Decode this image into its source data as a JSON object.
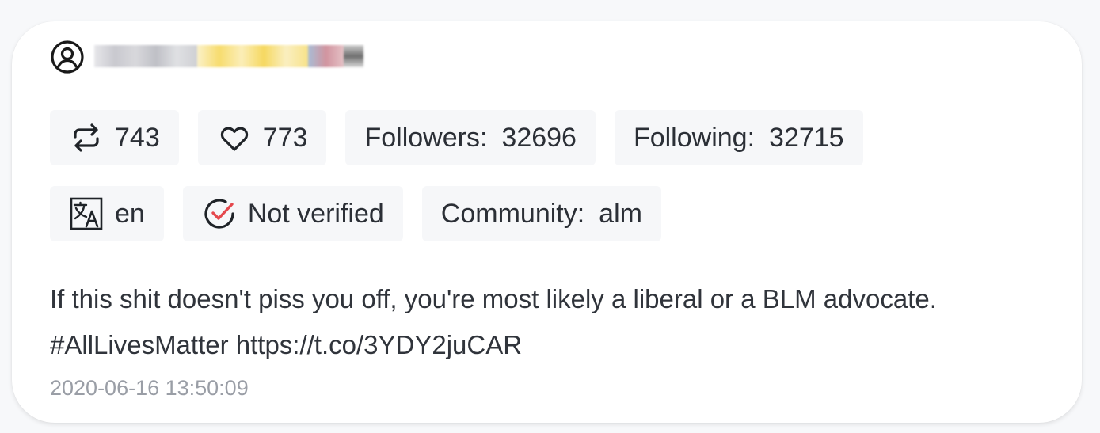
{
  "header": {
    "user_icon": "user-circle-icon",
    "username_redacted": true
  },
  "stats": {
    "retweets": {
      "icon": "retweet-icon",
      "value": "743"
    },
    "likes": {
      "icon": "heart-icon",
      "value": "773"
    },
    "followers": {
      "label": "Followers:",
      "value": "32696"
    },
    "following": {
      "label": "Following:",
      "value": "32715"
    }
  },
  "meta": {
    "language": {
      "icon": "translate-icon",
      "value": "en"
    },
    "verification": {
      "icon": "check-circle-icon",
      "value": "Not verified"
    },
    "community": {
      "label": "Community:",
      "value": "alm"
    }
  },
  "tweet": {
    "line1": "If this shit doesn't piss you off, you're most likely a liberal or a BLM advocate.",
    "line2": "#AllLivesMatter https://t.co/3YDY2juCAR",
    "timestamp": "2020-06-16 13:50:09"
  },
  "colors": {
    "card_bg": "#ffffff",
    "chip_bg": "#f6f7f9",
    "text": "#2b2f36",
    "muted": "#9a9ea6",
    "check_accent": "#e5484d"
  }
}
